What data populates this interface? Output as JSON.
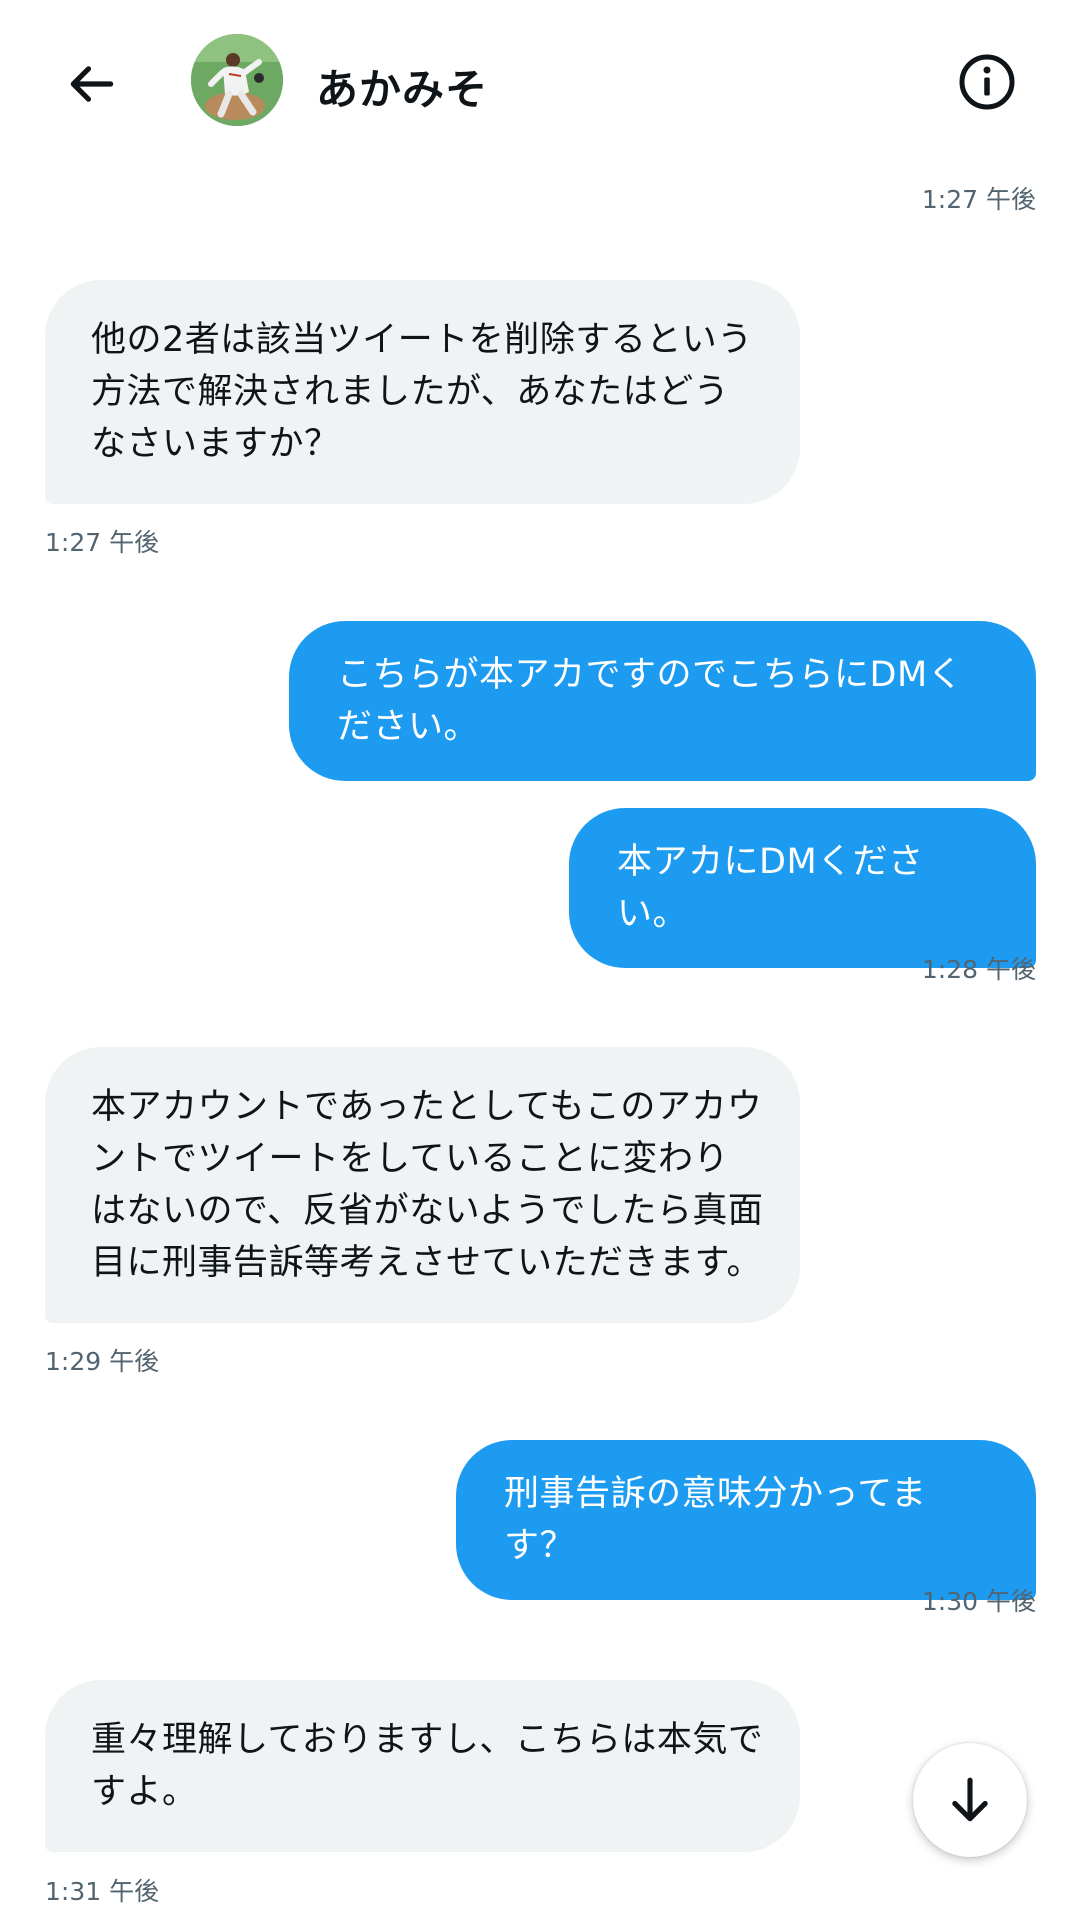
{
  "header": {
    "title": "あかみそ",
    "back_icon": "arrow-left-icon",
    "info_icon": "info-circle-icon",
    "avatar": "user-avatar-baseball-pitcher"
  },
  "messages": [
    {
      "side": "right",
      "type": "timestamp",
      "time": "1:27 午後"
    },
    {
      "side": "left",
      "text": "他の2者は該当ツイートを削除するという方法で解決されましたが、あなたはどうなさいますか？",
      "time": "1:27 午後"
    },
    {
      "side": "right",
      "text": "こちらが本アカですのでこちらにDMください。"
    },
    {
      "side": "right",
      "text": "本アカにDMください。",
      "time": "1:28 午後"
    },
    {
      "side": "left",
      "text": "本アカウントであったとしてもこのアカウントでツイートをしていることに変わりはないので、反省がないようでしたら真面目に刑事告訴等考えさせていただきます。",
      "time": "1:29 午後"
    },
    {
      "side": "right",
      "text": "刑事告訴の意味分かってます？",
      "time": "1:30 午後"
    },
    {
      "side": "left",
      "text": "重々理解しておりますし、こちらは本気ですよ。",
      "time": "1:31 午後"
    }
  ],
  "scroll_button_icon": "arrow-down-icon",
  "colors": {
    "outgoing_bubble": "#1d9bf0",
    "incoming_bubble": "#eff3f4",
    "timestamp": "#536471"
  }
}
